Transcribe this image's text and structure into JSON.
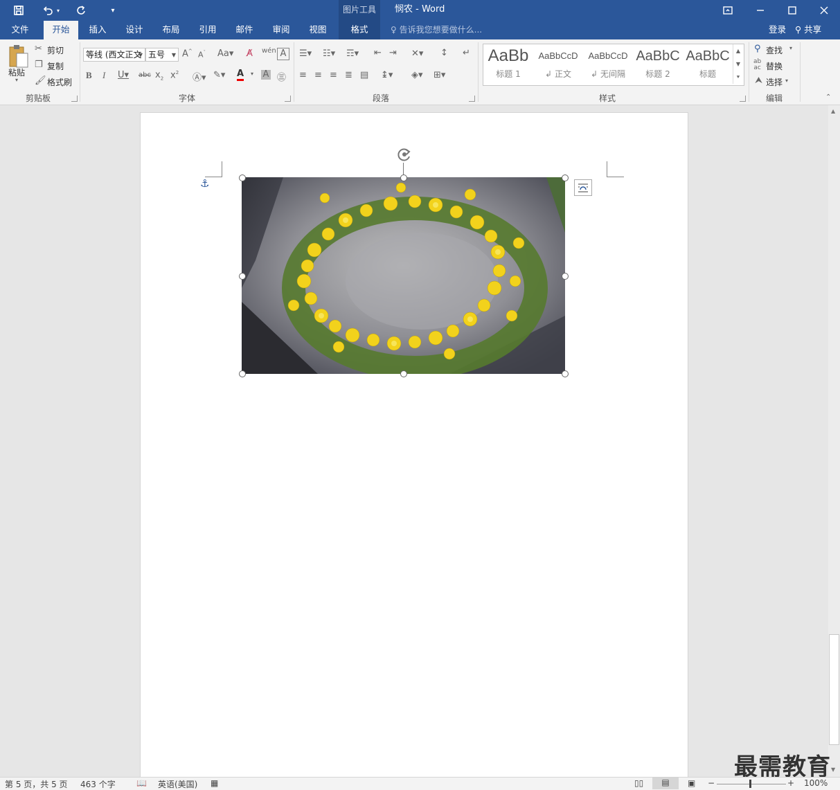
{
  "titlebar": {
    "context_group": "图片工具",
    "doc_title": "悯农 - Word"
  },
  "tabs": {
    "file": "文件",
    "home": "开始",
    "insert": "插入",
    "design": "设计",
    "layout": "布局",
    "references": "引用",
    "mailings": "邮件",
    "review": "审阅",
    "view": "视图",
    "format": "格式",
    "tell_me": "告诉我您想要做什么...",
    "login": "登录",
    "share": "共享"
  },
  "clipboard": {
    "paste": "粘贴",
    "cut": "剪切",
    "copy": "复制",
    "format_painter": "格式刷",
    "label": "剪贴板"
  },
  "font": {
    "font_name": "等线 (西文正文",
    "font_size": "五号",
    "label": "字体"
  },
  "paragraph": {
    "label": "段落"
  },
  "styles": {
    "label": "样式",
    "items": [
      {
        "sample": "AaBb",
        "name": "标题 1"
      },
      {
        "sample": "AaBbCcD",
        "name": "正文"
      },
      {
        "sample": "AaBbCcD",
        "name": "无间隔"
      },
      {
        "sample": "AaBbC",
        "name": "标题 2"
      },
      {
        "sample": "AaBbC",
        "name": "标题"
      }
    ]
  },
  "editing": {
    "find": "查找",
    "replace": "替换",
    "select": "选择",
    "label": "编辑"
  },
  "status": {
    "page": "第 5 页，共 5 页",
    "words": "463 个字",
    "language": "英语(美国)",
    "zoom": "100%"
  },
  "watermark": "最需教育"
}
